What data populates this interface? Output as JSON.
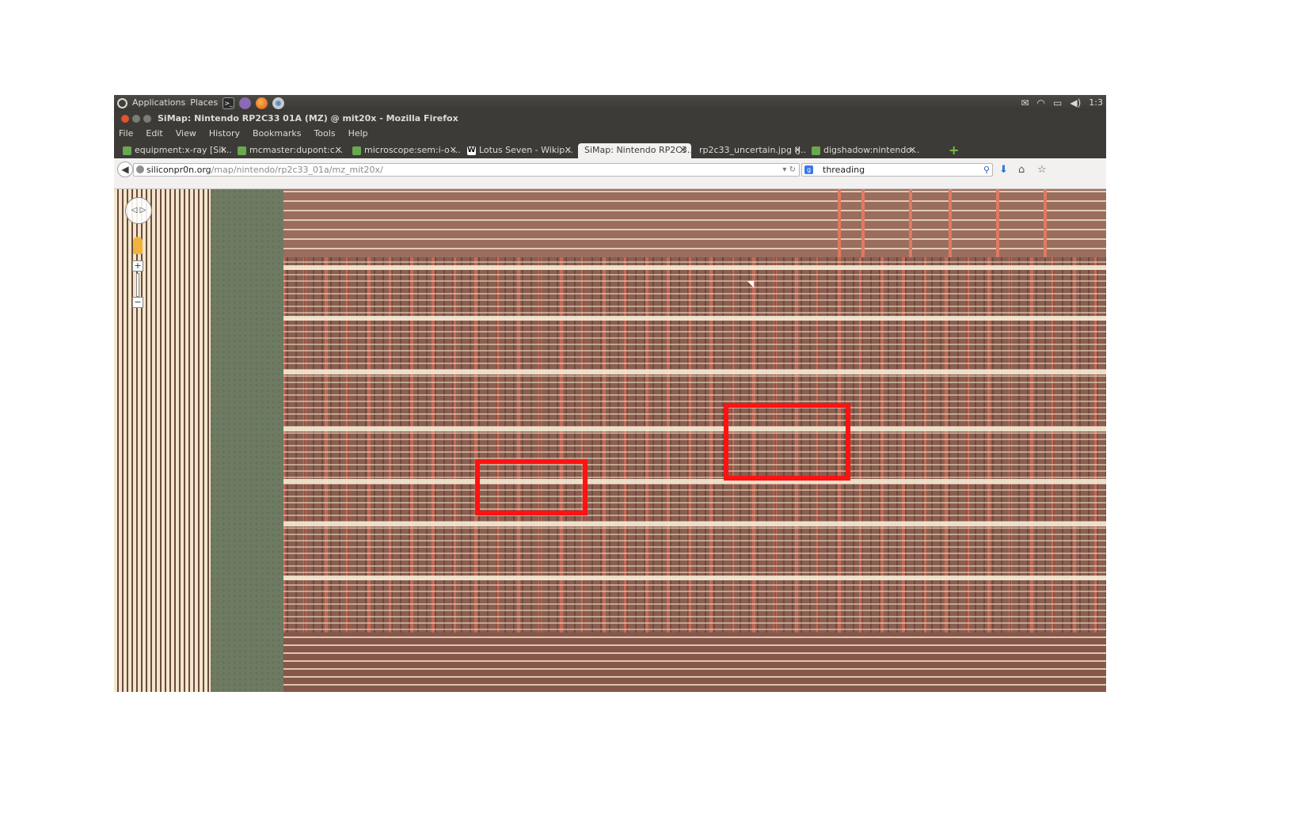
{
  "top_panel": {
    "applications": "Applications",
    "places": "Places",
    "clock": "1:3"
  },
  "window": {
    "title": "SiMap: Nintendo RP2C33 01A (MZ) @ mit20x - Mozilla Firefox"
  },
  "menu": [
    "File",
    "Edit",
    "View",
    "History",
    "Bookmarks",
    "Tools",
    "Help"
  ],
  "tabs": [
    {
      "label": "equipment:x-ray [Sil...",
      "favicon": "siliconpr0n-favicon",
      "active": false
    },
    {
      "label": "mcmaster:dupont:c...",
      "favicon": "siliconpr0n-favicon",
      "active": false
    },
    {
      "label": "microscope:sem:i-o ...",
      "favicon": "siliconpr0n-favicon",
      "active": false
    },
    {
      "label": "Lotus Seven - Wikip...",
      "favicon": "wikipedia-favicon",
      "active": false
    },
    {
      "label": "SiMap: Nintendo RP2C3...",
      "favicon": "",
      "active": true
    },
    {
      "label": "rp2c33_uncertain.jpg (J...",
      "favicon": "",
      "active": false
    },
    {
      "label": "digshadow:nintendo...",
      "favicon": "siliconpr0n-favicon",
      "active": false
    }
  ],
  "address": {
    "host": "siliconpr0n.org",
    "path": "/map/nintendo/rp2c33_01a/mz_mit20x/"
  },
  "search": {
    "value": "threading"
  },
  "colors": {
    "highlight": "#ff1212",
    "panel": "#3c3b37",
    "die_base": "#8a5f52"
  }
}
